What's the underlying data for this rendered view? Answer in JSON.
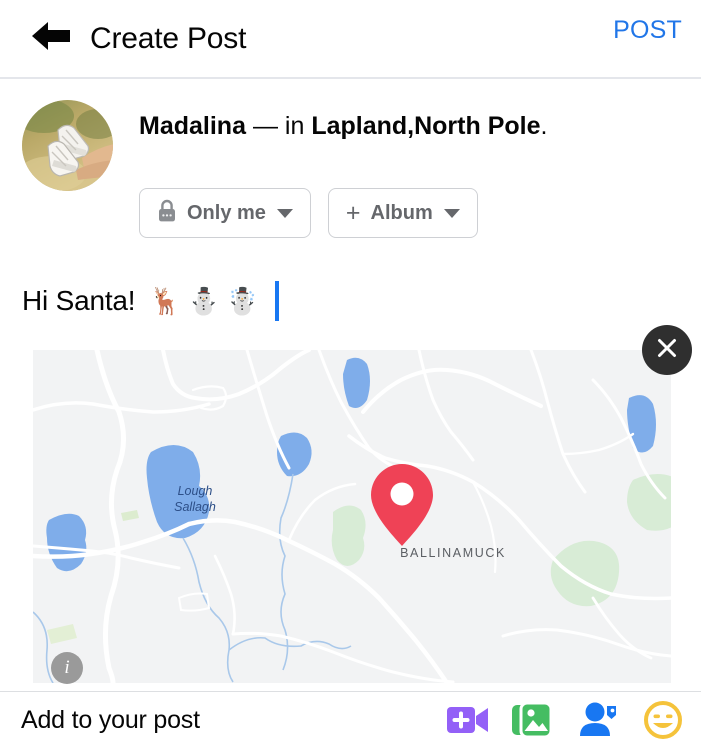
{
  "header": {
    "back_icon": "arrow-left-icon",
    "title": "Create Post",
    "post_label": "POST",
    "post_color": "#2176e8"
  },
  "user": {
    "avatar_alt": "sneakers-on-sand-photo",
    "name": "Madalina",
    "dash": "—",
    "in_word": "in",
    "place": "Lapland,North Pole",
    "period": "."
  },
  "audience_pill": {
    "icon": "lock-icon",
    "label": "Only me",
    "caret": "chevron-down-icon"
  },
  "album_pill": {
    "plus": "+",
    "label": "Album",
    "caret": "chevron-down-icon"
  },
  "composer": {
    "text": "Hi Santa!",
    "emoji": "🦌⛄☃️",
    "cursor_color": "#1877f2"
  },
  "map": {
    "close_icon": "close-icon",
    "info_icon": "info-icon",
    "info_glyph": "i",
    "pin_label": "map-pin",
    "pin_color": "#ef4256",
    "water_color": "#7fadea",
    "land_color": "#f2f3f4",
    "forest_color": "#d8ecd6",
    "road_color": "#ffffff",
    "labels": [
      {
        "text": "Lough Sallagh",
        "line1": "Lough",
        "line2": "Sallagh",
        "kind": "water"
      },
      {
        "text": "BALLINAMUCK",
        "kind": "place"
      }
    ]
  },
  "bottom": {
    "label": "Add to your post",
    "icons": [
      {
        "name": "live-video-icon",
        "color": "#9360f7"
      },
      {
        "name": "photo-library-icon",
        "color": "#45bd62"
      },
      {
        "name": "tag-people-icon",
        "color": "#1877f2"
      },
      {
        "name": "feeling-activity-icon",
        "color": "#f5c33b"
      }
    ]
  }
}
